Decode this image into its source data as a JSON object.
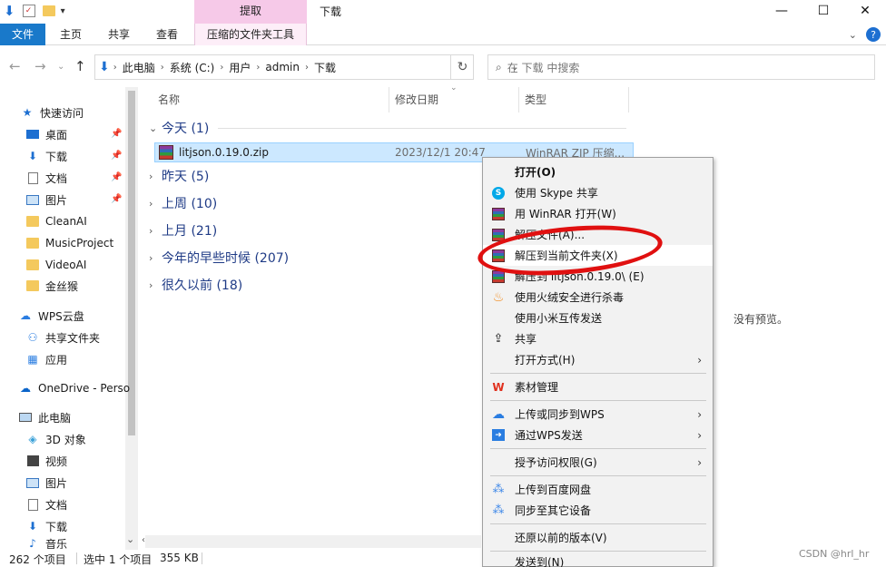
{
  "titlebar": {
    "context_header": "提取",
    "window_title": "下载",
    "minimize": "—",
    "maximize": "☐",
    "close": "✕"
  },
  "ribbon": {
    "tabs": [
      "文件",
      "主页",
      "共享",
      "查看",
      "压缩的文件夹工具"
    ]
  },
  "address": {
    "crumbs": [
      "此电脑",
      "系统 (C:)",
      "用户",
      "admin",
      "下载"
    ],
    "search_placeholder": "在 下载 中搜索"
  },
  "nav": {
    "quick_access": "快速访问",
    "pinned": [
      "桌面",
      "下载",
      "文档",
      "图片"
    ],
    "folders": [
      "CleanAI",
      "MusicProject",
      "VideoAI",
      "金丝猴"
    ],
    "wps_cloud": "WPS云盘",
    "wps_items": [
      "共享文件夹",
      "应用"
    ],
    "onedrive": "OneDrive - Perso",
    "this_pc": "此电脑",
    "pc_items": [
      "3D 对象",
      "视频",
      "图片",
      "文档",
      "下载",
      "音乐"
    ]
  },
  "columns": {
    "name": "名称",
    "modified": "修改日期",
    "type": "类型"
  },
  "groups": [
    {
      "label": "今天 (1)",
      "expanded": true
    },
    {
      "label": "昨天 (5)",
      "expanded": false
    },
    {
      "label": "上周 (10)",
      "expanded": false
    },
    {
      "label": "上月 (21)",
      "expanded": false
    },
    {
      "label": "今年的早些时候 (207)",
      "expanded": false
    },
    {
      "label": "很久以前 (18)",
      "expanded": false
    }
  ],
  "file": {
    "name": "litjson.0.19.0.zip",
    "modified": "2023/12/1 20:47",
    "type": "WinRAR ZIP 压缩..."
  },
  "preview": {
    "message": "没有预览。"
  },
  "status": {
    "count": "262 个项目",
    "selected": "选中 1 个项目",
    "size": "355 KB"
  },
  "context_menu": {
    "items": [
      {
        "label": "打开(O)"
      },
      {
        "label": "使用 Skype 共享"
      },
      {
        "label": "用 WinRAR 打开(W)"
      },
      {
        "label": "解压文件(A)..."
      },
      {
        "label": "解压到当前文件夹(X)"
      },
      {
        "label": "解压到 litjson.0.19.0\\ (E)"
      },
      {
        "label": "使用火绒安全进行杀毒"
      },
      {
        "label": "使用小米互传发送"
      },
      {
        "label": "共享"
      },
      {
        "label": "打开方式(H)"
      },
      {
        "label": "素材管理"
      },
      {
        "label": "上传或同步到WPS"
      },
      {
        "label": "通过WPS发送"
      },
      {
        "label": "授予访问权限(G)"
      },
      {
        "label": "上传到百度网盘"
      },
      {
        "label": "同步至其它设备"
      },
      {
        "label": "还原以前的版本(V)"
      },
      {
        "label": "发送到(N)"
      }
    ]
  },
  "watermark": "CSDN @hrl_hr"
}
